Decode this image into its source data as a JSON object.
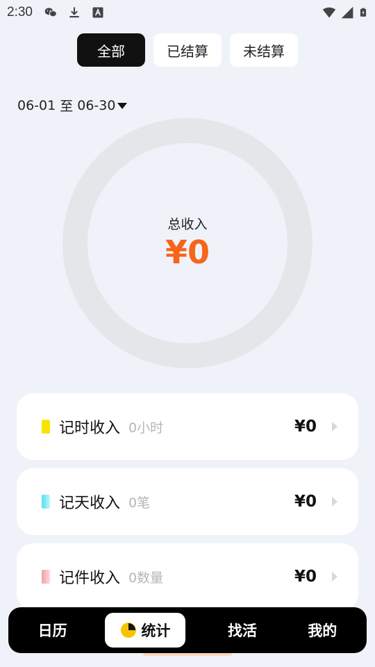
{
  "status_bar": {
    "time": "2:30",
    "icons": [
      "wechat-icon",
      "download-icon",
      "a-icon",
      "wifi-icon",
      "signal-icon",
      "battery-icon"
    ]
  },
  "filter_tabs": [
    {
      "label": "全部",
      "active": true
    },
    {
      "label": "已结算",
      "active": false
    },
    {
      "label": "未结算",
      "active": false
    }
  ],
  "date_range": {
    "start": "06-01",
    "separator": "至",
    "end": "06-30"
  },
  "summary": {
    "label": "总收入",
    "value": "¥0"
  },
  "income_cards": [
    {
      "title": "记时收入",
      "detail": "0小时",
      "amount": "¥0",
      "color": "#f7e400"
    },
    {
      "title": "记天收入",
      "detail": "0笔",
      "amount": "¥0",
      "color": "#7fe8f4"
    },
    {
      "title": "记件收入",
      "detail": "0数量",
      "amount": "¥0",
      "color": "#f7b9bb"
    }
  ],
  "bottom_nav": [
    {
      "label": "日历",
      "active": false
    },
    {
      "label": "统计",
      "active": true
    },
    {
      "label": "找活",
      "active": false
    },
    {
      "label": "我的",
      "active": false
    }
  ],
  "colors": {
    "accent": "#f7641a",
    "background": "#eff3f9",
    "active_tab": "#111111",
    "ring": "#e5e6ea"
  }
}
